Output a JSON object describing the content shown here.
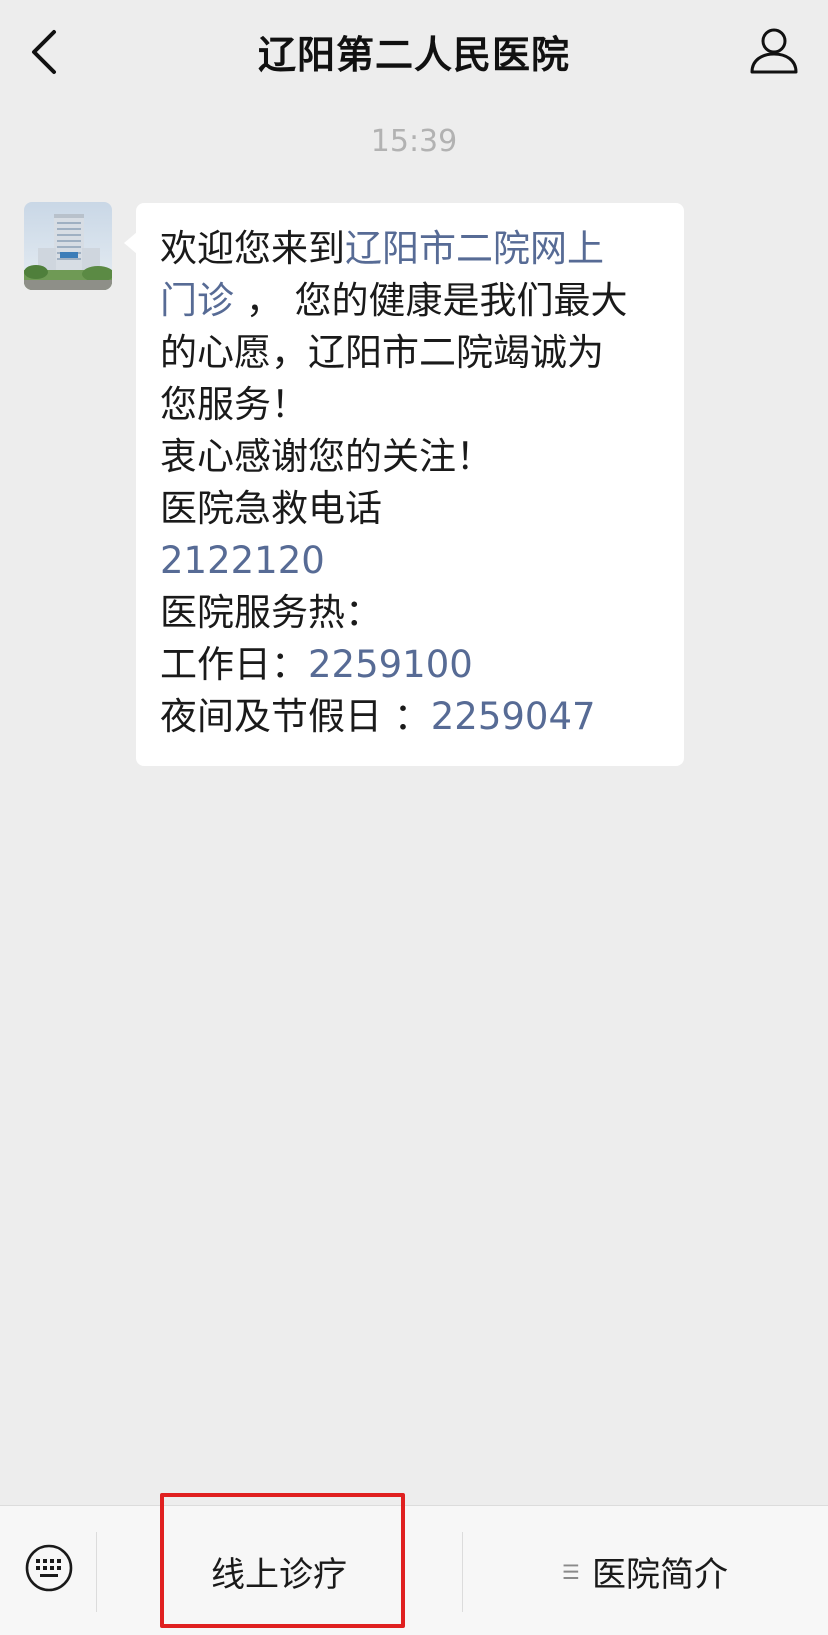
{
  "header": {
    "title": "辽阳第二人民医院"
  },
  "timestamp": "15:39",
  "message": {
    "lines": [
      [
        {
          "text": "欢迎您来到"
        },
        {
          "text": "辽阳市二院网上",
          "link": true
        }
      ],
      [
        {
          "text": "门诊",
          "link": true
        },
        {
          "text": " ， 您的健康是我们最大"
        }
      ],
      [
        {
          "text": "的心愿，辽阳市二院竭诚为"
        }
      ],
      [
        {
          "text": "您服务！"
        }
      ],
      [
        {
          "text": "衷心感谢您的关注！"
        }
      ],
      [
        {
          "text": "医院急救电话"
        }
      ],
      [
        {
          "text": "2122120",
          "link": true
        }
      ],
      [
        {
          "text": "医院服务热："
        }
      ],
      [
        {
          "text": "工作日："
        },
        {
          "text": "2259100",
          "link": true
        }
      ],
      [
        {
          "text": "夜间及节假日 ："
        },
        {
          "text": "2259047",
          "link": true
        }
      ]
    ]
  },
  "bottom_menu": {
    "items": [
      {
        "label": "线上诊疗"
      },
      {
        "label": "医院简介",
        "icon": "list-icon"
      }
    ],
    "highlight_color": "#e02020"
  },
  "colors": {
    "background": "#ededed",
    "bubble": "#ffffff",
    "link": "#576b95",
    "timestamp": "#b2b2b2"
  }
}
